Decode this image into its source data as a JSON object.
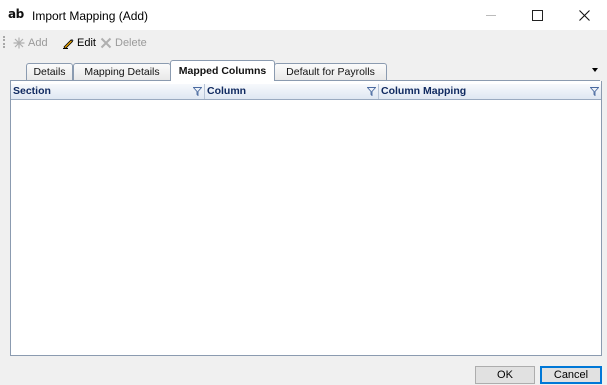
{
  "window": {
    "app_icon": "ab",
    "title": "Import Mapping (Add)"
  },
  "toolbar": {
    "add_label": "Add",
    "edit_label": "Edit",
    "delete_label": "Delete"
  },
  "tabs": [
    {
      "label": "Details",
      "active": false
    },
    {
      "label": "Mapping Details",
      "active": false
    },
    {
      "label": "Mapped Columns",
      "active": true
    },
    {
      "label": "Default for Payrolls",
      "active": false
    }
  ],
  "grid": {
    "columns": [
      "Section",
      "Column",
      "Column Mapping"
    ],
    "rows": []
  },
  "footer": {
    "ok_label": "OK",
    "cancel_label": "Cancel"
  },
  "colors": {
    "header_text": "#102a60",
    "border": "#8b9bb0",
    "default_button_border": "#0078d7"
  }
}
